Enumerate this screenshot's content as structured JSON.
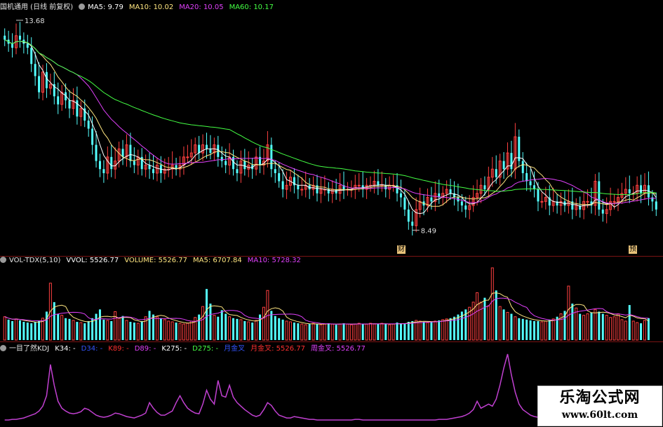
{
  "header_main": {
    "title": "国机通用 (日线 前复权)",
    "items": [
      {
        "text": "MA5: 9.79",
        "color": "#ffffff"
      },
      {
        "text": "MA10: 10.02",
        "color": "#ffe680"
      },
      {
        "text": "MA20: 10.05",
        "color": "#e040fb"
      },
      {
        "text": "MA60: 10.17",
        "color": "#44ff44"
      }
    ]
  },
  "header_vol": {
    "title": "VOL-TDX(5,10)",
    "items": [
      {
        "text": "VVOL: 5526.77",
        "color": "#ffffff"
      },
      {
        "text": "VOLUME: 5526.77",
        "color": "#ffe680"
      },
      {
        "text": "MA5: 6707.84",
        "color": "#ffe680"
      },
      {
        "text": "MA10: 5728.32",
        "color": "#e040fb"
      }
    ]
  },
  "header_kdj": {
    "title": "一目了然KDJ",
    "items": [
      {
        "text": "K34: -",
        "color": "#ffffff"
      },
      {
        "text": "D34: -",
        "color": "#3355ff"
      },
      {
        "text": "K89: -",
        "color": "#ff3030"
      },
      {
        "text": "D89: -",
        "color": "#e040fb"
      },
      {
        "text": "K275: -",
        "color": "#ffffff"
      },
      {
        "text": "D275: -",
        "color": "#44ff44"
      },
      {
        "text": "月金叉",
        "color": "#3355ff"
      },
      {
        "text": "月金叉: 5526.77",
        "color": "#ff3030"
      },
      {
        "text": "周金叉: 5526.77",
        "color": "#e040fb"
      }
    ]
  },
  "annotations": {
    "high": "13.68",
    "low": "8.49",
    "tag_cai": "财",
    "tag_yu": "预"
  },
  "watermark": {
    "title": "乐淘公式网",
    "url": "www.60lt.com"
  },
  "chart_data": {
    "type": "candlestick",
    "x": [
      1,
      2,
      3,
      4,
      5,
      6,
      7,
      8,
      9,
      10,
      11,
      12,
      13,
      14,
      15,
      16,
      17,
      18,
      19,
      20,
      21,
      22,
      23,
      24,
      25,
      26,
      27,
      28,
      29,
      30,
      31,
      32,
      33,
      34,
      35,
      36,
      37,
      38,
      39,
      40,
      41,
      42,
      43,
      44,
      45,
      46,
      47,
      48,
      49,
      50,
      51,
      52,
      53,
      54,
      55,
      56,
      57,
      58,
      59,
      60,
      61,
      62,
      63,
      64,
      65,
      66,
      67,
      68,
      69,
      70,
      71,
      72,
      73,
      74,
      75,
      76,
      77,
      78,
      79,
      80,
      81,
      82,
      83,
      84,
      85,
      86,
      87,
      88,
      89,
      90,
      91,
      92,
      93,
      94,
      95,
      96,
      97,
      98,
      99,
      100,
      101,
      102,
      103,
      104,
      105,
      106,
      107,
      108,
      109,
      110,
      111,
      112,
      113,
      114,
      115,
      116,
      117,
      118,
      119,
      120,
      121,
      122,
      123,
      124,
      125,
      126,
      127,
      128,
      129,
      130,
      131,
      132,
      133,
      134,
      135,
      136,
      137,
      138,
      139,
      140,
      141,
      142,
      143,
      144,
      145,
      146,
      147,
      148,
      149,
      150,
      151,
      152,
      153,
      154,
      155,
      156,
      157,
      158,
      159,
      160,
      161,
      162,
      163,
      164,
      165,
      166,
      167,
      168,
      169,
      170
    ],
    "close": [
      13.2,
      13.1,
      13.0,
      13.3,
      13.2,
      13.1,
      13.0,
      12.6,
      12.3,
      11.9,
      12.4,
      12.0,
      12.1,
      11.8,
      11.6,
      11.9,
      11.7,
      11.5,
      11.7,
      11.3,
      11.5,
      11.2,
      11.0,
      10.6,
      10.2,
      10.0,
      9.9,
      10.3,
      10.0,
      10.2,
      10.5,
      10.3,
      10.6,
      10.2,
      10.1,
      10.3,
      10.0,
      10.1,
      10.0,
      9.9,
      10.1,
      9.9,
      10.0,
      10.0,
      10.1,
      10.0,
      10.1,
      10.3,
      10.3,
      10.4,
      10.6,
      10.4,
      10.6,
      10.5,
      10.4,
      10.6,
      10.3,
      10.2,
      10.1,
      10.3,
      10.0,
      9.9,
      10.2,
      10.0,
      10.1,
      10.0,
      10.3,
      10.1,
      10.2,
      10.6,
      10.0,
      9.9,
      9.7,
      9.5,
      9.6,
      9.8,
      9.6,
      9.5,
      9.5,
      9.6,
      9.5,
      9.6,
      9.4,
      9.5,
      9.5,
      9.4,
      9.5,
      9.4,
      9.6,
      9.5,
      9.5,
      9.5,
      9.6,
      9.6,
      9.5,
      9.6,
      9.6,
      9.7,
      9.6,
      9.6,
      9.5,
      9.6,
      9.6,
      9.4,
      9.3,
      9.0,
      8.7,
      8.6,
      9.0,
      9.2,
      9.1,
      9.3,
      9.2,
      9.4,
      9.3,
      9.4,
      9.5,
      9.4,
      9.3,
      9.2,
      9.1,
      9.0,
      9.1,
      9.3,
      9.4,
      9.6,
      9.5,
      9.8,
      10.0,
      9.8,
      10.2,
      10.0,
      10.4,
      10.0,
      10.8,
      10.2,
      9.9,
      9.7,
      9.6,
      9.5,
      9.2,
      9.2,
      9.3,
      9.1,
      9.2,
      9.1,
      9.2,
      9.1,
      9.2,
      9.0,
      9.1,
      9.0,
      9.2,
      9.2,
      9.1,
      9.7,
      9.0,
      8.9,
      9.0,
      9.2,
      9.2,
      9.3,
      9.4,
      9.5,
      9.4,
      9.4,
      9.6,
      9.4,
      9.6,
      9.3,
      9.2,
      9.0
    ],
    "volume_series": [
      {
        "name": "VOLUME",
        "values": [
          3200,
          2800,
          2600,
          2900,
          2700,
          2500,
          2400,
          2300,
          2500,
          2600,
          3000,
          3900,
          7800,
          5200,
          3600,
          3400,
          3000,
          2900,
          2700,
          2500,
          2400,
          2300,
          2600,
          3000,
          3600,
          4200,
          2800,
          2700,
          2600,
          3900,
          3000,
          3300,
          2700,
          2500,
          2400,
          2300,
          2600,
          3200,
          4000,
          3500,
          3200,
          3000,
          2800,
          2600,
          2500,
          2400,
          2300,
          2200,
          2300,
          2600,
          3100,
          3500,
          4600,
          7000,
          5000,
          3400,
          3200,
          4100,
          3600,
          3200,
          3000,
          2900,
          2800,
          2600,
          2500,
          2400,
          2700,
          3500,
          4500,
          6800,
          4000,
          3300,
          3000,
          2800,
          2600,
          2500,
          2400,
          2300,
          2200,
          2100,
          2200,
          2300,
          2200,
          2100,
          2200,
          2300,
          2200,
          2100,
          2200,
          2300,
          2200,
          2100,
          2200,
          2300,
          2200,
          2200,
          2300,
          2200,
          2200,
          2300,
          2200,
          2100,
          2200,
          2400,
          2300,
          2300,
          2500,
          2600,
          2700,
          2600,
          2500,
          2400,
          2500,
          2600,
          2700,
          2800,
          2900,
          3000,
          3200,
          3500,
          3900,
          4200,
          4500,
          5200,
          6500,
          5200,
          5800,
          4700,
          9900,
          6800,
          4600,
          4200,
          3800,
          3600,
          3200,
          3000,
          2900,
          2800,
          2700,
          2600,
          2600,
          2500,
          2600,
          2800,
          2900,
          3200,
          3600,
          4000,
          7400,
          5000,
          4400,
          3600,
          3400,
          3600,
          3800,
          4200,
          3900,
          3600,
          3400,
          3100,
          3200,
          3600,
          2800,
          2600,
          4800,
          2600,
          2400,
          2300,
          2700,
          3000
        ]
      }
    ],
    "kdj_series": [
      {
        "name": "KDJ",
        "values": [
          0.05,
          0.05,
          0.06,
          0.06,
          0.07,
          0.08,
          0.1,
          0.12,
          0.14,
          0.18,
          0.25,
          0.4,
          0.85,
          0.55,
          0.32,
          0.22,
          0.18,
          0.15,
          0.14,
          0.15,
          0.17,
          0.22,
          0.2,
          0.16,
          0.12,
          0.1,
          0.09,
          0.1,
          0.12,
          0.15,
          0.14,
          0.12,
          0.1,
          0.09,
          0.08,
          0.1,
          0.12,
          0.15,
          0.3,
          0.22,
          0.16,
          0.12,
          0.12,
          0.15,
          0.18,
          0.3,
          0.4,
          0.3,
          0.22,
          0.18,
          0.15,
          0.14,
          0.28,
          0.48,
          0.35,
          0.28,
          0.62,
          0.4,
          0.38,
          0.55,
          0.38,
          0.3,
          0.25,
          0.2,
          0.16,
          0.12,
          0.1,
          0.12,
          0.2,
          0.3,
          0.26,
          0.18,
          0.12,
          0.1,
          0.08,
          0.08,
          0.1,
          0.09,
          0.08,
          0.07,
          0.06,
          0.06,
          0.05,
          0.05,
          0.05,
          0.05,
          0.05,
          0.05,
          0.05,
          0.05,
          0.05,
          0.05,
          0.06,
          0.06,
          0.05,
          0.05,
          0.05,
          0.05,
          0.05,
          0.05,
          0.05,
          0.05,
          0.05,
          0.05,
          0.05,
          0.05,
          0.05,
          0.05,
          0.05,
          0.05,
          0.05,
          0.05,
          0.05,
          0.05,
          0.06,
          0.06,
          0.06,
          0.07,
          0.08,
          0.09,
          0.1,
          0.12,
          0.15,
          0.2,
          0.32,
          0.22,
          0.25,
          0.28,
          0.25,
          0.35,
          0.55,
          0.8,
          1.0,
          0.7,
          0.45,
          0.28,
          0.2,
          0.16,
          0.12,
          0.1,
          0.09,
          0.08,
          0.09,
          0.1,
          0.12,
          0.14,
          0.16,
          0.18,
          0.2,
          0.22,
          0.18,
          0.14,
          0.12,
          0.1,
          0.09,
          0.08,
          0.08,
          0.07,
          0.06,
          0.05,
          0.05,
          0.05,
          0.05,
          0.05,
          0.05,
          0.05,
          0.04,
          0.04,
          0.04,
          0.04
        ]
      }
    ],
    "ylim": [
      8.2,
      13.8
    ],
    "legend": "top-left",
    "grid": false
  }
}
